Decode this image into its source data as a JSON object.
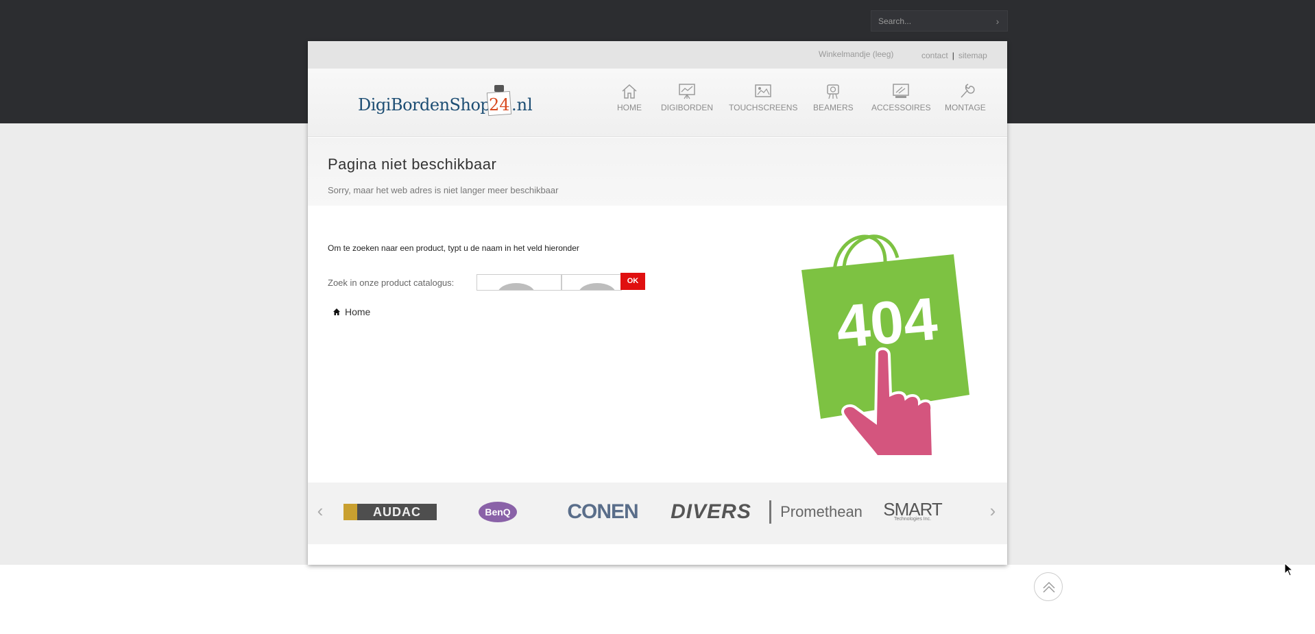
{
  "top_search": {
    "placeholder": "Search..."
  },
  "utility": {
    "cart": "Winkelmandje (leeg)",
    "links": [
      {
        "label": "contact"
      },
      {
        "label": "sitemap"
      }
    ],
    "separator": "|"
  },
  "logo": {
    "text": "DigiBordenShop",
    "number": "24",
    "tld": ".nl"
  },
  "nav": [
    {
      "label": "HOME",
      "icon": "home-icon"
    },
    {
      "label": "DIGIBORDEN",
      "icon": "chart-board-icon"
    },
    {
      "label": "TOUCHSCREENS",
      "icon": "image-frame-icon"
    },
    {
      "label": "BEAMERS",
      "icon": "projector-icon"
    },
    {
      "label": "ACCESSOIRES",
      "icon": "accessories-icon"
    },
    {
      "label": "MONTAGE",
      "icon": "wrench-icon"
    }
  ],
  "page": {
    "title": "Pagina niet beschikbaar",
    "subtitle": "Sorry, maar het web adres is niet langer meer beschikbaar",
    "intro": "Om te zoeken naar een product, typt u de naam in het veld hieronder",
    "search_label": "Zoek in onze product catalogus:",
    "ok_label": "OK",
    "home_label": "Home"
  },
  "error_graphic": {
    "code": "404",
    "bag_color": "#7dc242",
    "hand_color": "#d4557e"
  },
  "brands": [
    {
      "name": "AUDAC"
    },
    {
      "name": "BenQ"
    },
    {
      "name": "CONEN"
    },
    {
      "name": "DIVERS"
    },
    {
      "name": "Promethean"
    },
    {
      "name": "SMART",
      "tagline": "Technologies Inc."
    }
  ],
  "colors": {
    "accent_red": "#e01010",
    "dark_bar": "#2c2d30"
  }
}
